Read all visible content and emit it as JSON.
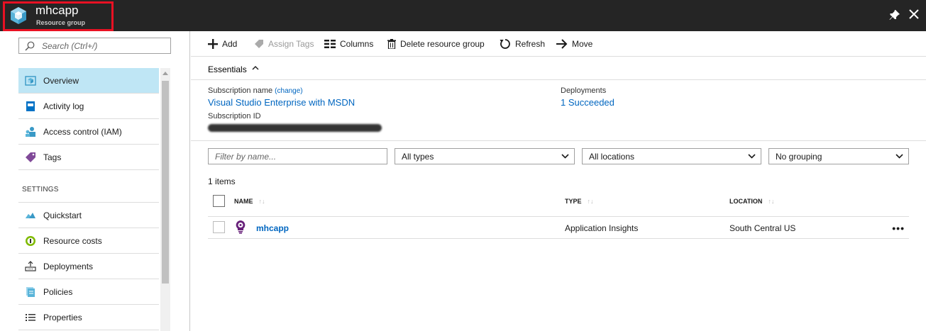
{
  "header": {
    "title": "mhcapp",
    "subtitle": "Resource group"
  },
  "sidebar": {
    "search_placeholder": "Search (Ctrl+/)",
    "items": [
      {
        "label": "Overview",
        "icon": "overview-icon"
      },
      {
        "label": "Activity log",
        "icon": "activity-log-icon"
      },
      {
        "label": "Access control (IAM)",
        "icon": "access-control-icon"
      },
      {
        "label": "Tags",
        "icon": "tag-icon"
      }
    ],
    "settings_label": "SETTINGS",
    "settings_items": [
      {
        "label": "Quickstart",
        "icon": "quickstart-icon"
      },
      {
        "label": "Resource costs",
        "icon": "resource-costs-icon"
      },
      {
        "label": "Deployments",
        "icon": "deployments-icon"
      },
      {
        "label": "Policies",
        "icon": "policies-icon"
      },
      {
        "label": "Properties",
        "icon": "properties-icon"
      }
    ]
  },
  "toolbar": {
    "add": "Add",
    "assign_tags": "Assign Tags",
    "columns": "Columns",
    "delete": "Delete resource group",
    "refresh": "Refresh",
    "move": "Move"
  },
  "essentials": {
    "label": "Essentials",
    "subscription_name_label": "Subscription name",
    "change_link": "(change)",
    "subscription_name": "Visual Studio Enterprise with MSDN",
    "subscription_id_label": "Subscription ID",
    "deployments_label": "Deployments",
    "deployments_value": "1 Succeeded"
  },
  "filters": {
    "name_placeholder": "Filter by name...",
    "type": "All types",
    "location": "All locations",
    "grouping": "No grouping"
  },
  "items_count": "1 items",
  "table": {
    "columns": [
      "NAME",
      "TYPE",
      "LOCATION"
    ],
    "rows": [
      {
        "name": "mhcapp",
        "type": "Application Insights",
        "location": "South Central US"
      }
    ]
  },
  "colors": {
    "header_bg": "#252525",
    "highlight": "#e81123",
    "link": "#0066c0",
    "active_nav": "#bfe6f5"
  }
}
